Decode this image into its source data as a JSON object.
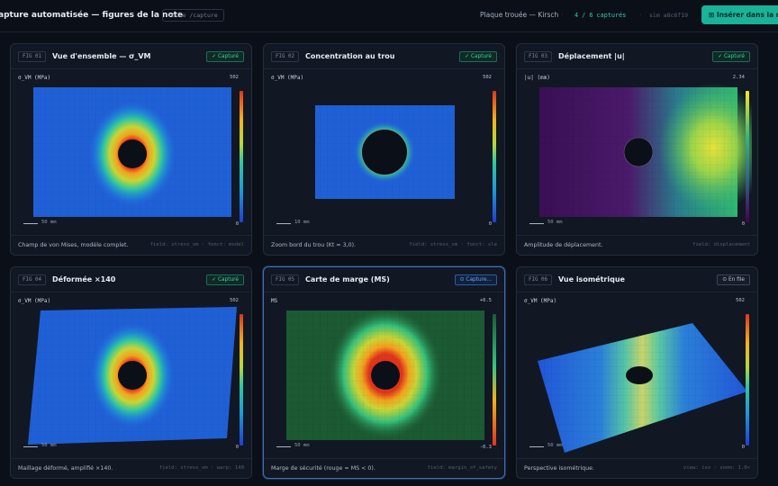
{
  "header": {
    "title": "apture automatisée — figures de la note",
    "path": "route /capture",
    "document": "Plaque trouée — Kirsch",
    "progress": "4 / 6 capturés",
    "sha": "sim a8c6f19",
    "insert_label": "⊞ Insérer dans la no"
  },
  "colors": {
    "accent": "#19b39a",
    "captured": "#3fd0a3",
    "capturing": "#6aa6ff"
  },
  "figures": [
    {
      "tag": "FIG 01",
      "title": "Vue d'ensemble — σ_VM",
      "status": "✓ Capturé",
      "status_kind": "captured",
      "field": "σ_VM (MPa)",
      "cmax": "502",
      "cmin": "0",
      "scale": "50 mm",
      "caption": "Champ de von Mises, modèle complet.",
      "meta": "field: stress_vm · fonct: model"
    },
    {
      "tag": "FIG 02",
      "title": "Concentration au trou",
      "status": "✓ Capturé",
      "status_kind": "captured",
      "field": "σ_VM (MPa)",
      "cmax": "502",
      "cmin": "0",
      "scale": "10 mm",
      "caption": "Zoom bord du trou (Kt ≈ 3,0).",
      "meta": "field: stress_vm · fonct: sle"
    },
    {
      "tag": "FIG 03",
      "title": "Déplacement |u|",
      "status": "✓ Capturé",
      "status_kind": "captured",
      "field": "|u| (mm)",
      "cmax": "2.34",
      "cmin": "0",
      "scale": "50 mm",
      "caption": "Amplitude de déplacement.",
      "meta": "field: displacement"
    },
    {
      "tag": "FIG 04",
      "title": "Déformée ×140",
      "status": "✓ Capturé",
      "status_kind": "captured",
      "field": "σ_VM (MPa)",
      "cmax": "502",
      "cmin": "0",
      "scale": "50 mm",
      "caption": "Maillage déformé, amplifié ×140.",
      "meta": "field: stress_vm · warp: 140"
    },
    {
      "tag": "FIG 05",
      "title": "Carte de marge (MS)",
      "status": "⊙ Capture...",
      "status_kind": "capturing",
      "field": "MS",
      "cmax": "+0.5",
      "cmin": "-0.3",
      "scale": "50 mm",
      "caption": "Marge de sécurité (rouge = MS < 0).",
      "meta": "field: margin_of_safety"
    },
    {
      "tag": "FIG 06",
      "title": "Vue isométrique",
      "status": "⊙ En file",
      "status_kind": "queued",
      "field": "σ_VM (MPa)",
      "cmax": "502",
      "cmin": "0",
      "scale": "50 mm",
      "caption": "Perspective isométrique.",
      "meta": "view: iso · zoom: 1.0×"
    }
  ]
}
